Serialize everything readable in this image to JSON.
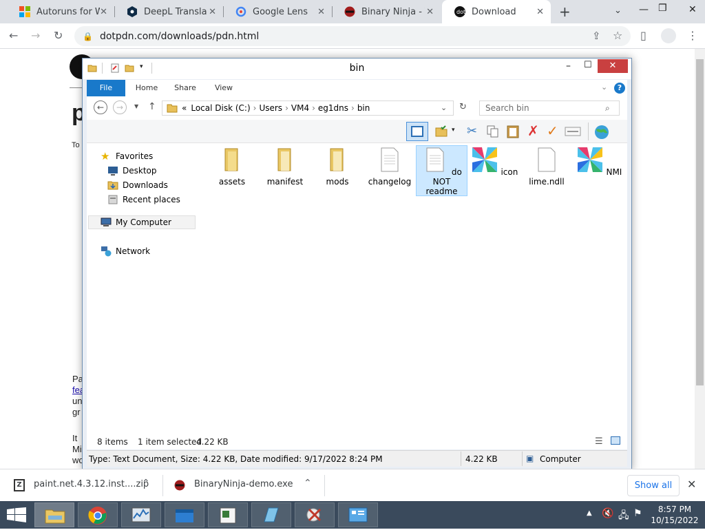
{
  "browser": {
    "tabs": [
      {
        "title": "Autoruns for Windows",
        "icon": "windows-icon"
      },
      {
        "title": "DeepL Translate:",
        "icon": "deepl-icon"
      },
      {
        "title": "Google Lens",
        "icon": "google-lens-icon"
      },
      {
        "title": "Binary Ninja - Try",
        "icon": "binary-ninja-icon"
      },
      {
        "title": "Download",
        "icon": "dotpdn-icon",
        "active": true
      }
    ],
    "new_tab": "+",
    "url": "dotpdn.com/downloads/pdn.html"
  },
  "page": {
    "heading": "p",
    "line1": "To",
    "para_a": [
      "Pa",
      "fea",
      "un",
      "gr"
    ],
    "para_b": [
      "It",
      "Mi",
      "wo"
    ]
  },
  "explorer": {
    "title": "bin",
    "ribbon_tabs": [
      "File",
      "Home",
      "Share",
      "View"
    ],
    "breadcrumb": [
      "«",
      "Local Disk (C:)",
      "Users",
      "VM4",
      "eg1dns",
      "bin"
    ],
    "search_placeholder": "Search bin",
    "nav": {
      "favorites": "Favorites",
      "desktop": "Desktop",
      "downloads": "Downloads",
      "recent": "Recent places",
      "computer": "My Computer",
      "network": "Network"
    },
    "files": [
      {
        "name": "assets",
        "type": "folder"
      },
      {
        "name": "manifest",
        "type": "folder"
      },
      {
        "name": "mods",
        "type": "folder"
      },
      {
        "name": "changelog",
        "type": "document"
      },
      {
        "name": "do NOT readme",
        "type": "document",
        "selected": true
      },
      {
        "name": "icon",
        "type": "app"
      },
      {
        "name": "lime.ndll",
        "type": "document"
      },
      {
        "name": "NMI",
        "type": "app"
      }
    ],
    "status_items": "8 items",
    "status_selected": "1 item selected",
    "status_size": "4.22 KB",
    "details_text": "Type: Text Document, Size: 4.22 KB, Date modified: 9/17/2022 8:24 PM",
    "details_size": "4.22 KB",
    "details_location": "Computer"
  },
  "downloads": {
    "items": [
      {
        "name": "paint.net.4.3.12.inst....zip"
      },
      {
        "name": "BinaryNinja-demo.exe"
      }
    ],
    "show_all": "Show all"
  },
  "taskbar": {
    "time": "8:57 PM",
    "date": "10/15/2022"
  },
  "colors": {
    "file_tab": "#1979ca",
    "selection": "#cce8ff",
    "close_button": "#c94040",
    "taskbar": "#3a4a5c",
    "link": "#1a73e8"
  }
}
